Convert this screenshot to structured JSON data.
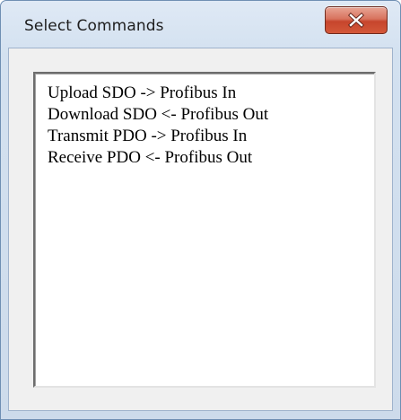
{
  "window": {
    "title": "Select Commands",
    "close_label": "x"
  },
  "listbox": {
    "items": [
      "Upload SDO -> Profibus In",
      "Download SDO <- Profibus Out",
      "Transmit PDO -> Profibus In",
      "Receive PDO <- Profibus Out"
    ]
  },
  "colors": {
    "close_button": "#c6452c",
    "frame": "#d3e1f0",
    "client": "#f0f0f0"
  },
  "icons": {
    "close": "close-icon"
  }
}
